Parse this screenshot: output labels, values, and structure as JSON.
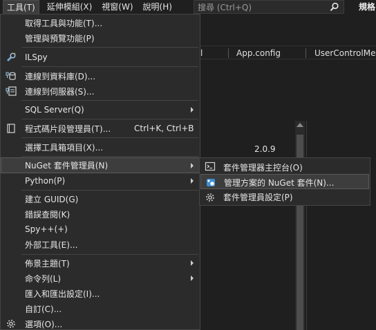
{
  "menubar": {
    "items": [
      "工具(T)",
      "延伸模組(X)",
      "視窗(W)",
      "說明(H)"
    ],
    "search_placeholder": "搜尋 (Ctrl+Q)",
    "right_title": "規格"
  },
  "editor": {
    "tabs": [
      "l",
      "App.config",
      "UserControlMen"
    ],
    "version_value": "2.0.9"
  },
  "tools_menu": {
    "items": [
      {
        "label": "取得工具與功能(T)..."
      },
      {
        "label": "管理與預覽功能(P)"
      },
      {
        "label": "ILSpy",
        "icon": "ilspy-icon"
      },
      {
        "label": "連線到資料庫(D)...",
        "icon": "database-connect-icon"
      },
      {
        "label": "連線到伺服器(S)...",
        "icon": "server-connect-icon"
      },
      {
        "label": "SQL Server(Q)",
        "submenu": true
      },
      {
        "label": "程式碼片段管理員(T)...",
        "shortcut": "Ctrl+K, Ctrl+B",
        "icon": "snippet-icon"
      },
      {
        "label": "選擇工具箱項目(X)..."
      },
      {
        "label": "NuGet 套件管理員(N)",
        "submenu": true
      },
      {
        "label": "Python(P)",
        "submenu": true
      },
      {
        "label": "建立 GUID(G)"
      },
      {
        "label": "錯誤查閱(K)"
      },
      {
        "label": "Spy++(+)"
      },
      {
        "label": "外部工具(E)..."
      },
      {
        "label": "佈景主題(T)",
        "submenu": true
      },
      {
        "label": "命令列(L)",
        "submenu": true
      },
      {
        "label": "匯入和匯出設定(I)..."
      },
      {
        "label": "自訂(C)..."
      },
      {
        "label": "選項(O)...",
        "icon": "gear-icon"
      }
    ]
  },
  "nuget_submenu": {
    "items": [
      {
        "label": "套件管理器主控台(O)",
        "icon": "console-icon"
      },
      {
        "label": "管理方案的 NuGet 套件(N)...",
        "icon": "nuget-icon"
      },
      {
        "label": "套件管理員設定(P)",
        "icon": "gear-icon"
      }
    ]
  },
  "colors": {
    "menu_bg": "#2b2b2b",
    "highlight_bg": "#3d3d3d",
    "nuget_blue": "#3b8fd6"
  }
}
